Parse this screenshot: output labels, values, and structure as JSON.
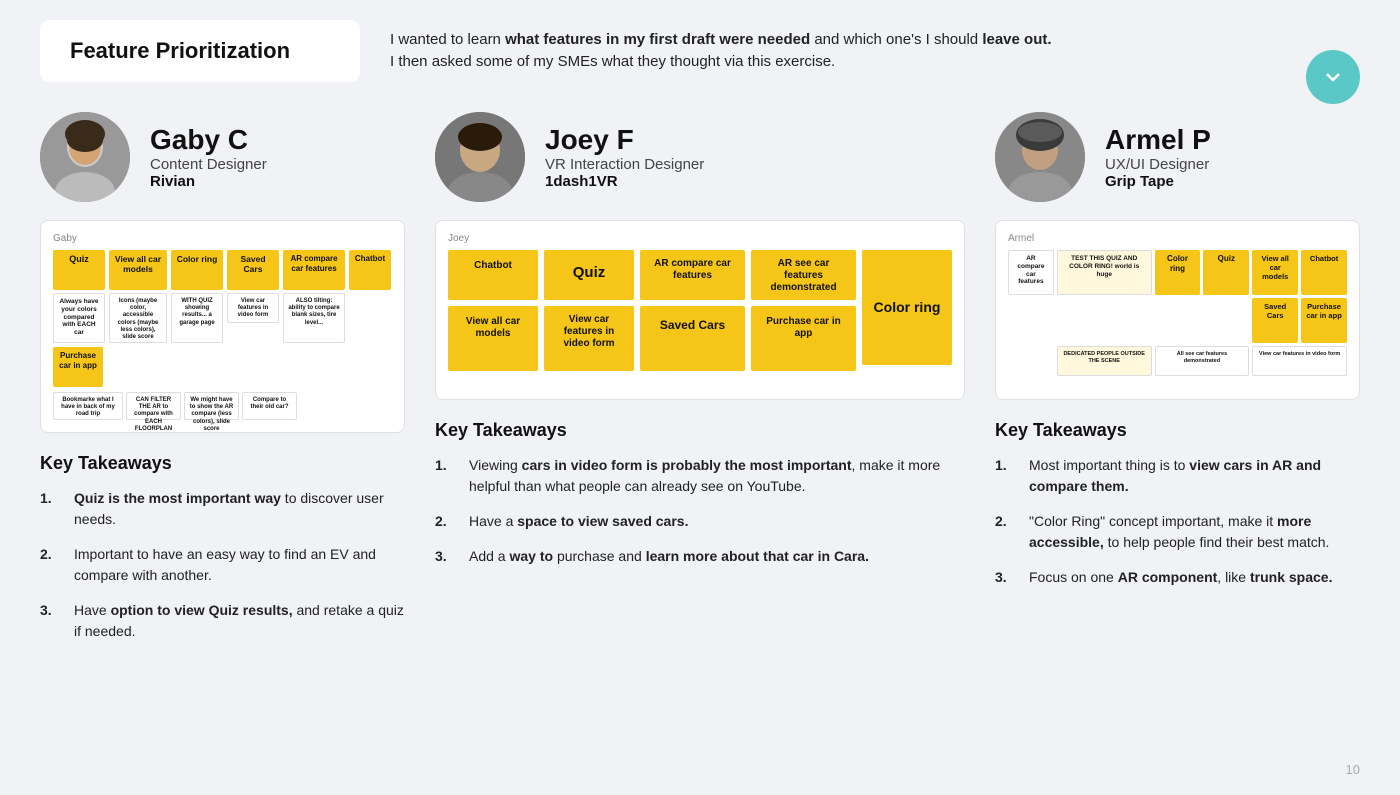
{
  "header": {
    "title": "Feature Prioritization",
    "description_start": "I wanted to learn ",
    "description_bold1": "what features in my first draft were needed",
    "description_middle": " and which one's I should ",
    "description_bold2": "leave out.",
    "description_end": "\nI then asked some of my SMEs what they thought via this exercise."
  },
  "page_number": "10",
  "persons": [
    {
      "id": "gaby",
      "name": "Gaby C",
      "role": "Content Designer",
      "company": "Rivian",
      "board_label": "Gaby",
      "takeaways_title": "Key Takeaways",
      "takeaways": [
        {
          "bold": "Quiz is the most important way",
          "rest": " to discover user needs."
        },
        {
          "prefix": "Important to have an easy way to find an EV and compare with another.",
          "bold": "",
          "rest": ""
        },
        {
          "prefix": "Have ",
          "bold": "option to view Quiz results,",
          "rest": " and retake a quiz if needed."
        }
      ]
    },
    {
      "id": "joey",
      "name": "Joey F",
      "role": "VR Interaction Designer",
      "company": "1dash1VR",
      "board_label": "Joey",
      "takeaways_title": "Key Takeaways",
      "takeaways": [
        {
          "prefix": "Viewing ",
          "bold": "cars in video form is probably the most important",
          "rest": ", make it more helpful than what people can already see on YouTube."
        },
        {
          "prefix": "Have a ",
          "bold": "space to view saved cars.",
          "rest": ""
        },
        {
          "prefix": "Add a ",
          "bold": "way to",
          "rest": " purchase and ",
          "bold2": "learn more about that car in Cara.",
          "rest2": ""
        }
      ]
    },
    {
      "id": "armel",
      "name": "Armel P",
      "role": "UX/UI Designer",
      "company": "Grip Tape",
      "board_label": "Armel",
      "takeaways_title": "Key Takeaways",
      "takeaways": [
        {
          "prefix": "Most important thing is to ",
          "bold": "view cars in AR and compare them.",
          "rest": ""
        },
        {
          "prefix": "\"Color Ring\" concept important, make it ",
          "bold": "more accessible,",
          "rest": " to help people find their best match."
        },
        {
          "prefix": "Focus on one ",
          "bold": "AR component",
          "rest": ", like ",
          "bold2": "trunk space.",
          "rest2": ""
        }
      ]
    }
  ],
  "joey_notes": {
    "row1": [
      "Chatbot",
      "Quiz",
      "AR compare car features",
      "AR see car features demonstrated",
      "Color ring"
    ],
    "row2": [
      "View all car models",
      "View car features in video form",
      "Saved Cars",
      "Purchase car in app",
      ""
    ]
  },
  "gaby_notes": {
    "items": [
      "Quiz",
      "View all car models",
      "Color ring",
      "Saved Cars",
      "AR compare car features",
      "Chatbot",
      "Purchase car in app"
    ]
  },
  "armel_notes": {
    "items": [
      "AR compare car features",
      "TEST THIS QUIZ AND COLOR RING!",
      "Color ring",
      "Quiz",
      "View all car models",
      "Chatbot",
      "Saved Cars",
      "Purchase car in app",
      "DEDICATED PEOPLE OUTSIDE THE SCENE",
      "All see car features demonstrated",
      "View car features in video form"
    ]
  }
}
